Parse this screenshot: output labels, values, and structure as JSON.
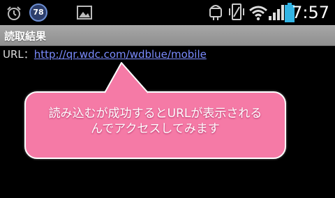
{
  "status_bar": {
    "notification_count": "78",
    "time": "7:57",
    "icons": [
      "alarm-icon",
      "badge-78-icon",
      "image-icon",
      "android-icon",
      "vibrate-icon",
      "wifi-icon",
      "signal-icon",
      "battery-icon"
    ]
  },
  "title_bar": {
    "title": "読取結果"
  },
  "content": {
    "url_label": "URL：",
    "url_value": "http://qr.wdc.com/wdblue/mobile"
  },
  "callout": {
    "line1": "読み込むが成功するとURLが表示される",
    "line2": "んでアクセスしてみます",
    "color": "#f57aa6"
  }
}
